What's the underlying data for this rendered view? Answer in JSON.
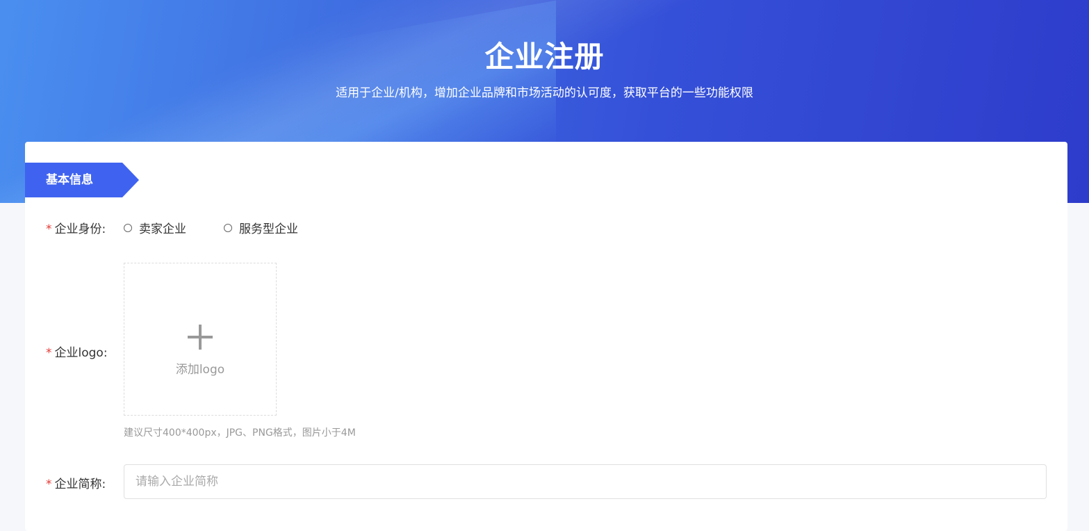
{
  "header": {
    "title": "企业注册",
    "subtitle": "适用于企业/机构，增加企业品牌和市场活动的认可度，获取平台的一些功能权限"
  },
  "section": {
    "title": "基本信息"
  },
  "form": {
    "required_mark": "*",
    "identity": {
      "label": "企业身份:",
      "options": [
        "卖家企业",
        "服务型企业"
      ]
    },
    "logo": {
      "label": "企业logo:",
      "upload_text": "添加logo",
      "hint": "建议尺寸400*400px，JPG、PNG格式，图片小于4M"
    },
    "short_name": {
      "label": "企业简称:",
      "placeholder": "请输入企业简称",
      "value": ""
    }
  },
  "colors": {
    "accent": "#3f63f0",
    "required": "#e53935"
  }
}
